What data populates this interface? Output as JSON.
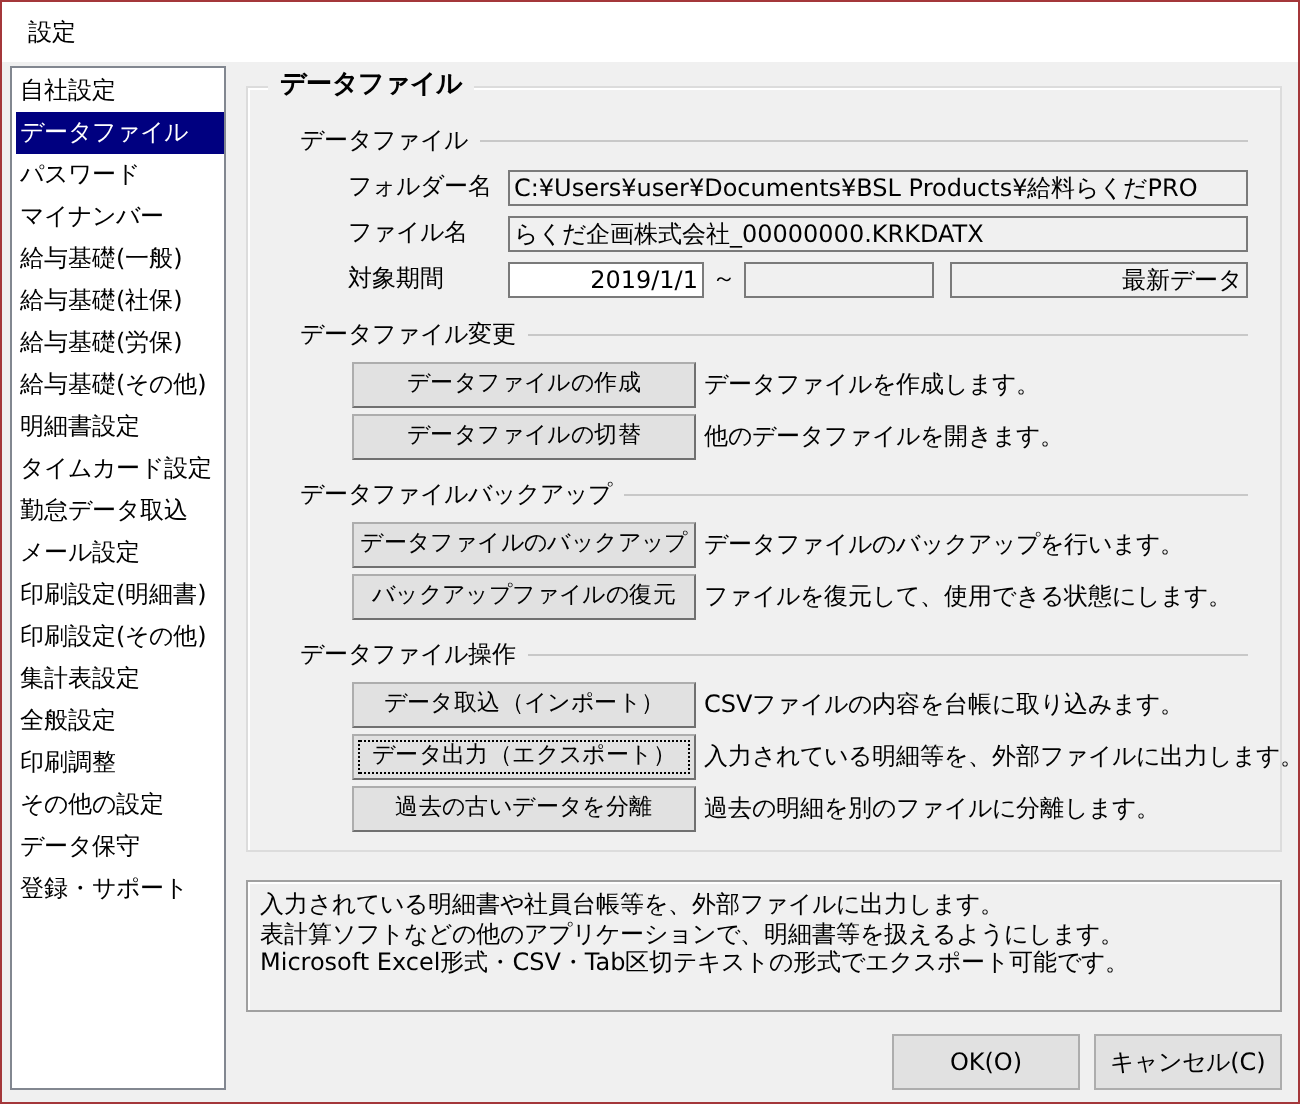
{
  "window": {
    "title": "設定"
  },
  "sidebar": {
    "items": [
      {
        "label": "自社設定",
        "selected": false
      },
      {
        "label": "データファイル",
        "selected": true
      },
      {
        "label": "パスワード",
        "selected": false
      },
      {
        "label": "マイナンバー",
        "selected": false
      },
      {
        "label": "給与基礎(一般)",
        "selected": false
      },
      {
        "label": "給与基礎(社保)",
        "selected": false
      },
      {
        "label": "給与基礎(労保)",
        "selected": false
      },
      {
        "label": "給与基礎(その他)",
        "selected": false
      },
      {
        "label": "明細書設定",
        "selected": false
      },
      {
        "label": "タイムカード設定",
        "selected": false
      },
      {
        "label": "勤怠データ取込",
        "selected": false
      },
      {
        "label": "メール設定",
        "selected": false
      },
      {
        "label": "印刷設定(明細書)",
        "selected": false
      },
      {
        "label": "印刷設定(その他)",
        "selected": false
      },
      {
        "label": "集計表設定",
        "selected": false
      },
      {
        "label": "全般設定",
        "selected": false
      },
      {
        "label": "印刷調整",
        "selected": false
      },
      {
        "label": "その他の設定",
        "selected": false
      },
      {
        "label": "データ保守",
        "selected": false
      },
      {
        "label": "登録・サポート",
        "selected": false
      }
    ]
  },
  "panel": {
    "title": "データファイル",
    "sections": [
      {
        "kind": "fields",
        "title": "データファイル",
        "fields": [
          {
            "kind": "text",
            "label": "フォルダー名",
            "value": "C:¥Users¥user¥Documents¥BSL Products¥給料らくだPRO"
          },
          {
            "kind": "text",
            "label": "ファイル名",
            "value": "らくだ企画株式会社_00000000.KRKDATX"
          },
          {
            "kind": "range",
            "label": "対象期間",
            "start": "2019/1/1",
            "separator": "～",
            "note": "最新データ"
          }
        ]
      },
      {
        "kind": "actions",
        "title": "データファイル変更",
        "actions": [
          {
            "button": "データファイルの作成",
            "description": "データファイルを作成します。",
            "focused": false
          },
          {
            "button": "データファイルの切替",
            "description": "他のデータファイルを開きます。",
            "focused": false
          }
        ]
      },
      {
        "kind": "actions",
        "title": "データファイルバックアップ",
        "actions": [
          {
            "button": "データファイルのバックアップ",
            "description": "データファイルのバックアップを行います。",
            "focused": false
          },
          {
            "button": "バックアップファイルの復元",
            "description": "ファイルを復元して、使用できる状態にします。",
            "focused": false
          }
        ]
      },
      {
        "kind": "actions",
        "title": "データファイル操作",
        "actions": [
          {
            "button": "データ取込（インポート）",
            "description": "CSVファイルの内容を台帳に取り込みます。",
            "focused": false
          },
          {
            "button": "データ出力（エクスポート）",
            "description": "入力されている明細等を、外部ファイルに出力します。",
            "focused": true
          },
          {
            "button": "過去の古いデータを分離",
            "description": "過去の明細を別のファイルに分離します。",
            "focused": false
          }
        ]
      }
    ]
  },
  "help_text": [
    "入力されている明細書や社員台帳等を、外部ファイルに出力します。",
    "表計算ソフトなどの他のアプリケーションで、明細書等を扱えるようにします。",
    "Microsoft Excel形式・CSV・Tab区切テキストの形式でエクスポート可能です。"
  ],
  "buttons": [
    "OK(O)",
    "キャンセル(C)"
  ]
}
